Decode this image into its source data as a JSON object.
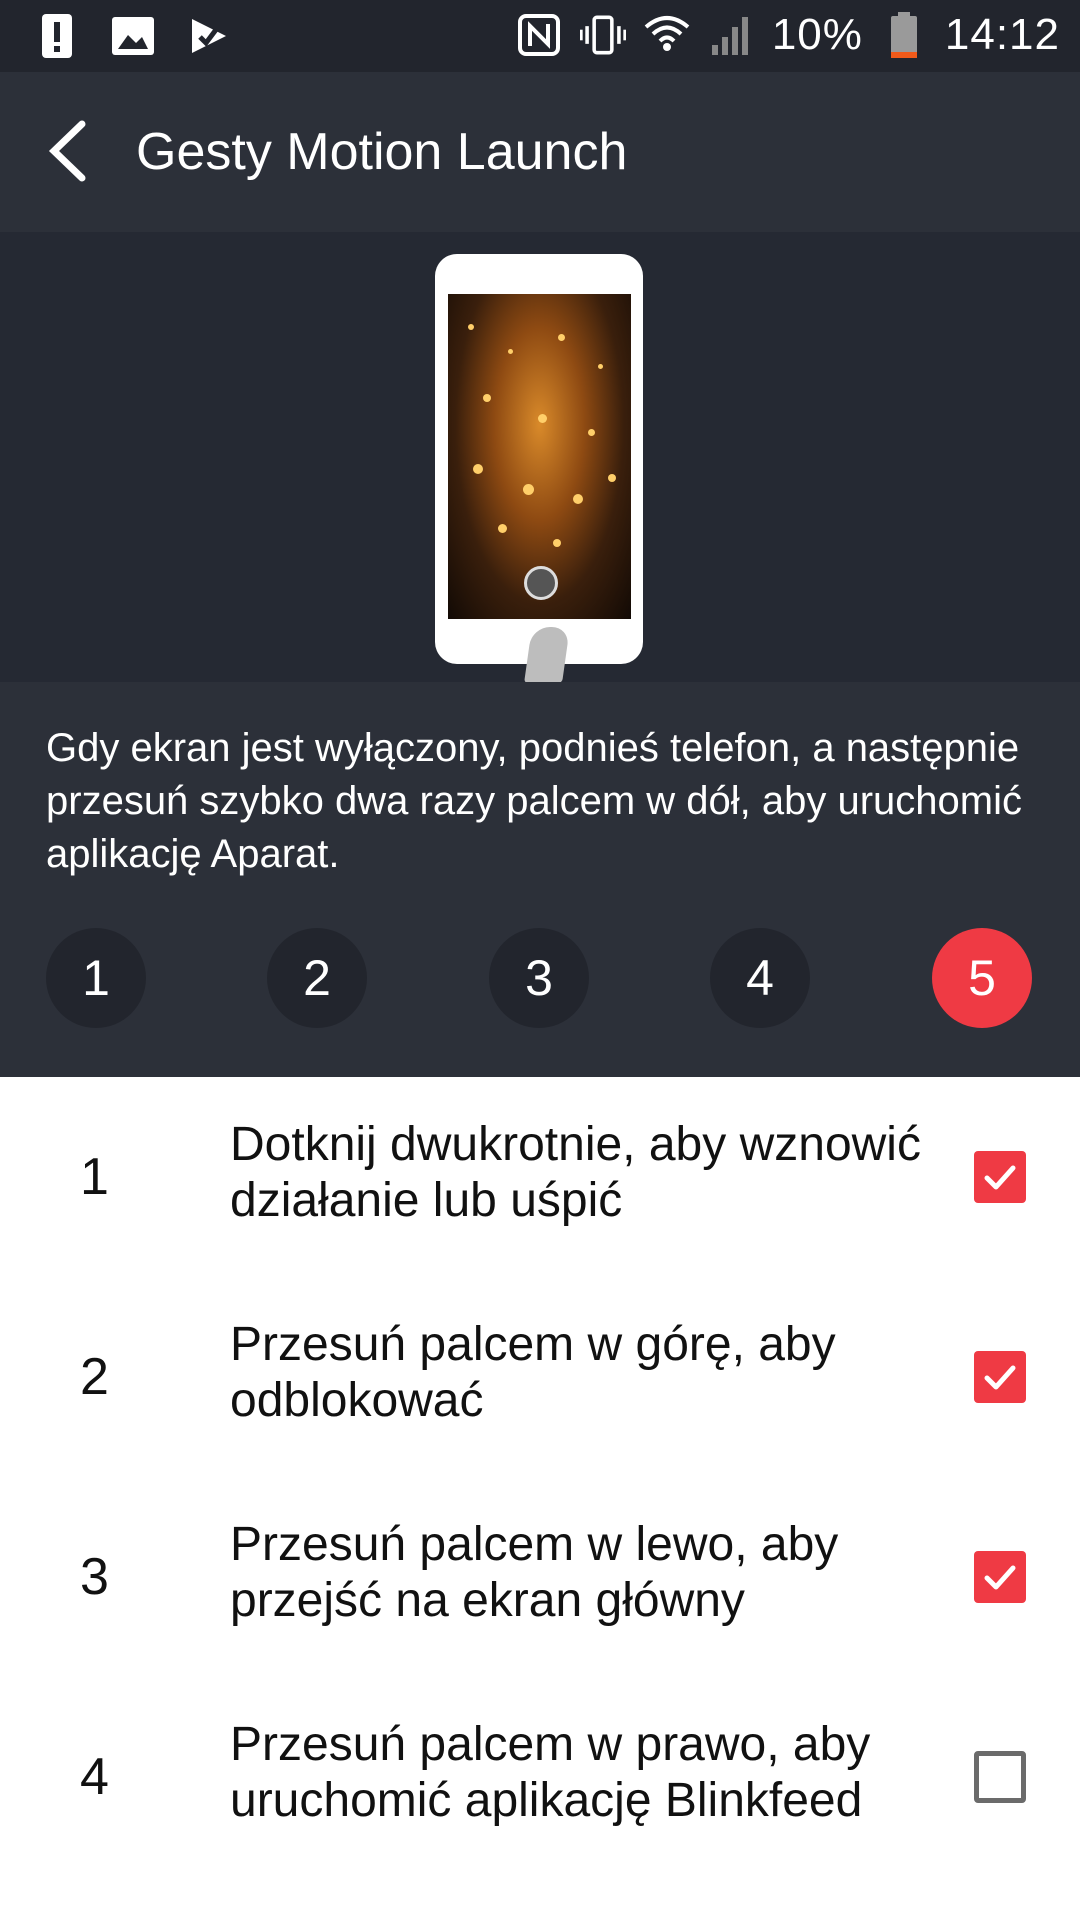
{
  "status_bar": {
    "battery_percent": "10%",
    "time": "14:12",
    "left_icons": [
      "alert-icon",
      "image-icon",
      "play-store-icon"
    ],
    "right_icons": [
      "nfc-icon",
      "vibrate-icon",
      "wifi-icon",
      "signal-icon",
      "battery-icon"
    ]
  },
  "header": {
    "title": "Gesty Motion Launch"
  },
  "description": "Gdy ekran jest wyłączony, podnieś telefon, a następnie przesuń szybko dwa razy palcem w dół, aby uruchomić aplikację Aparat.",
  "steps": [
    {
      "label": "1",
      "active": false
    },
    {
      "label": "2",
      "active": false
    },
    {
      "label": "3",
      "active": false
    },
    {
      "label": "4",
      "active": false
    },
    {
      "label": "5",
      "active": true
    }
  ],
  "gestures": [
    {
      "number": "1",
      "text": "Dotknij dwukrotnie, aby wznowić działanie lub uśpić",
      "checked": true
    },
    {
      "number": "2",
      "text": "Przesuń palcem w górę, aby odblokować",
      "checked": true
    },
    {
      "number": "3",
      "text": "Przesuń palcem w lewo, aby przejść na ekran główny",
      "checked": true
    },
    {
      "number": "4",
      "text": "Przesuń palcem w prawo, aby uruchomić aplikację Blinkfeed",
      "checked": false
    }
  ],
  "colors": {
    "accent": "#ef3a44",
    "status_bar": "#22252d",
    "app_bar": "#2c3039",
    "hero": "#252933"
  }
}
